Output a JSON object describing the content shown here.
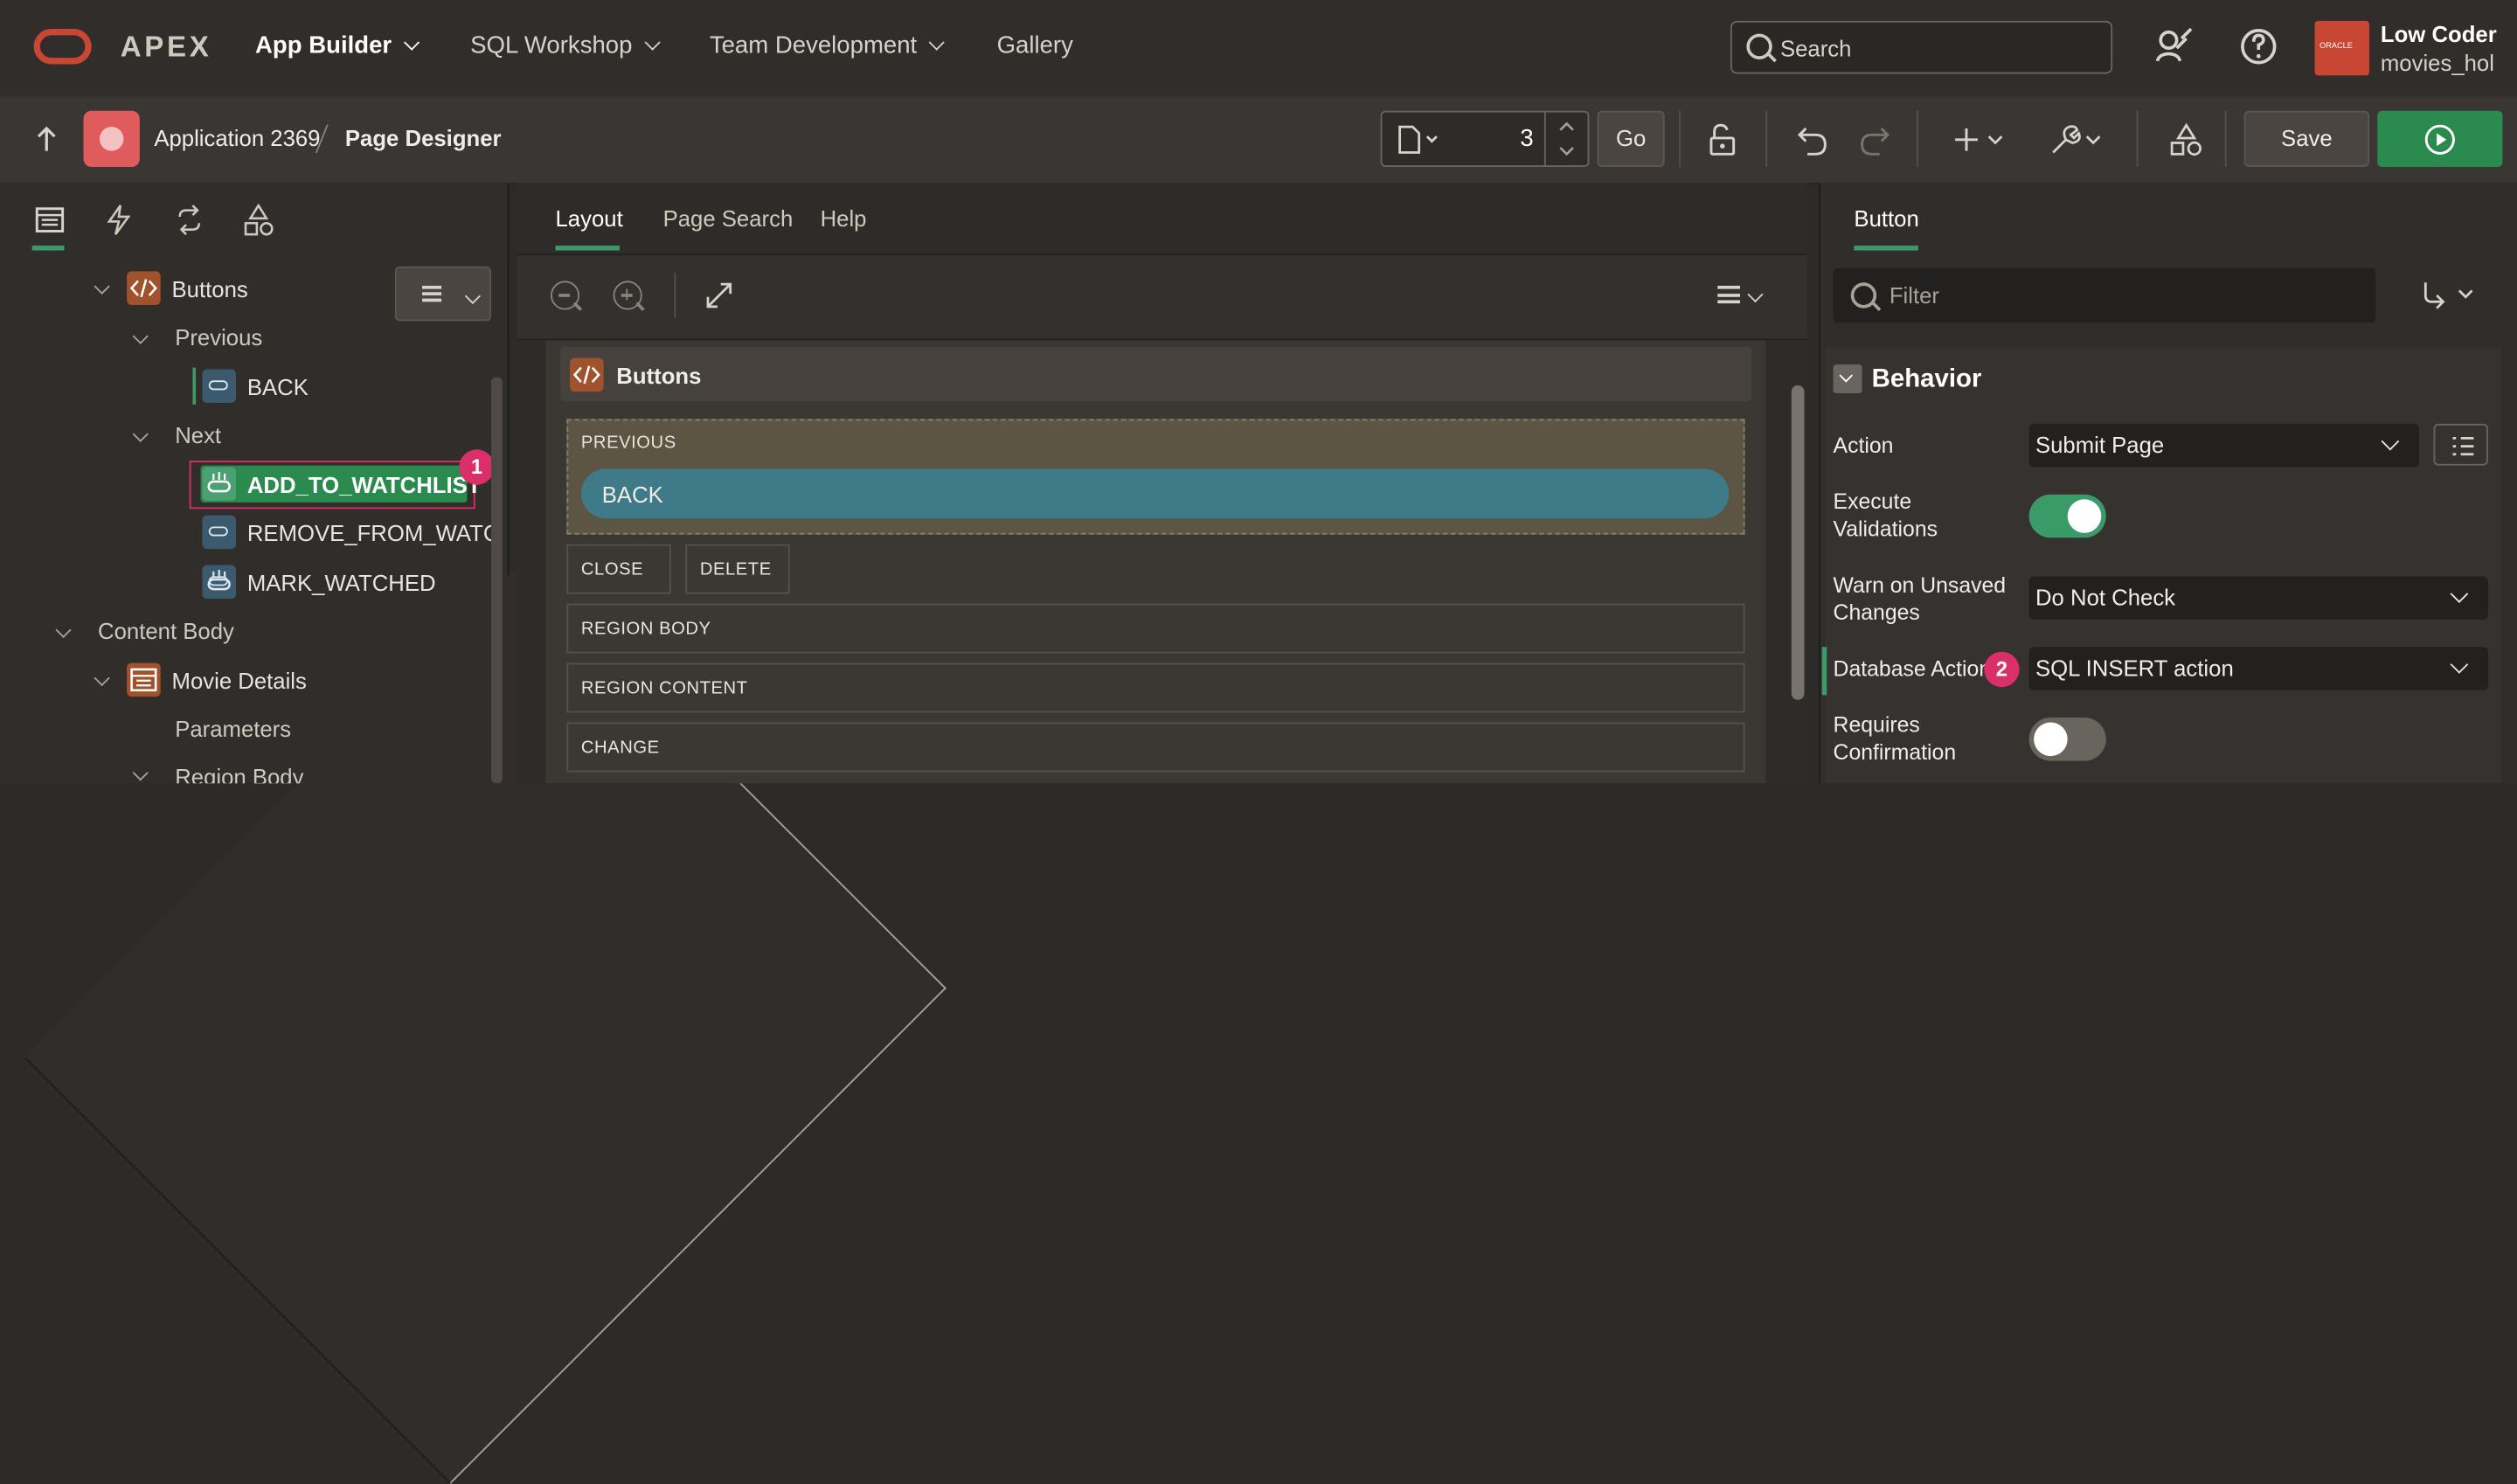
{
  "topnav": {
    "brand": "APEX",
    "menu": [
      {
        "label": "App Builder",
        "bold": true
      },
      {
        "label": "SQL Workshop"
      },
      {
        "label": "Team Development"
      },
      {
        "label": "Gallery"
      }
    ],
    "search_placeholder": "Search",
    "user_name": "Low Coder",
    "user_workspace": "movies_hol",
    "avatar_text": "ORACLE",
    "icons": [
      "oracle-logo-icon",
      "admin-wrench-user-icon",
      "help-icon",
      "chevron-down-icon"
    ]
  },
  "toolbar": {
    "breadcrumb_app": "Application 2369",
    "breadcrumb_page": "Page Designer",
    "page_number": "3",
    "go_label": "Go",
    "save_label": "Save",
    "icons": [
      "up-arrow-icon",
      "page-icon",
      "lock-icon",
      "undo-icon",
      "redo-icon",
      "plus-icon",
      "wrench-icon",
      "shared-components-icon",
      "run-icon"
    ]
  },
  "left_panel": {
    "tabs": [
      "rendering-tab-icon",
      "dynamic-actions-tab-icon",
      "processing-tab-icon",
      "shared-components-tab-icon"
    ],
    "tree": {
      "buttons": "Buttons",
      "previous": "Previous",
      "back": "BACK",
      "next": "Next",
      "add_to_watchlist": "ADD_TO_WATCHLIST",
      "remove_from_watchlist": "REMOVE_FROM_WATCHL",
      "mark_watched": "MARK_WATCHED",
      "content_body": "Content Body",
      "movie_details": "Movie Details",
      "parameters": "Parameters",
      "region_body": "Region Body"
    },
    "callout_1": "1"
  },
  "center_panel": {
    "tabs": [
      {
        "label": "Layout",
        "active": true
      },
      {
        "label": "Page Search"
      },
      {
        "label": "Help"
      }
    ],
    "region_title": "Buttons",
    "slots": {
      "previous": "PREVIOUS",
      "back_button": "BACK",
      "close": "CLOSE",
      "delete": "DELETE",
      "region_body": "REGION BODY",
      "region_content": "REGION CONTENT",
      "change": "CHANGE"
    }
  },
  "right_panel": {
    "tab": "Button",
    "filter_placeholder": "Filter",
    "section": "Behavior",
    "props": {
      "action_label": "Action",
      "action_value": "Submit Page",
      "exec_validations_label": "Execute Validations",
      "exec_validations_on": true,
      "warn_label": "Warn on Unsaved Changes",
      "warn_value": "Do Not Check",
      "db_action_label": "Database Action",
      "db_action_value": "SQL INSERT action",
      "requires_confirmation_label": "Requires Confirmation",
      "requires_confirmation_on": false
    },
    "callout_2": "2"
  },
  "colors": {
    "accent_green": "#2b8a4e",
    "callout_pink": "#d9306a",
    "oracle_red": "#c74634"
  }
}
